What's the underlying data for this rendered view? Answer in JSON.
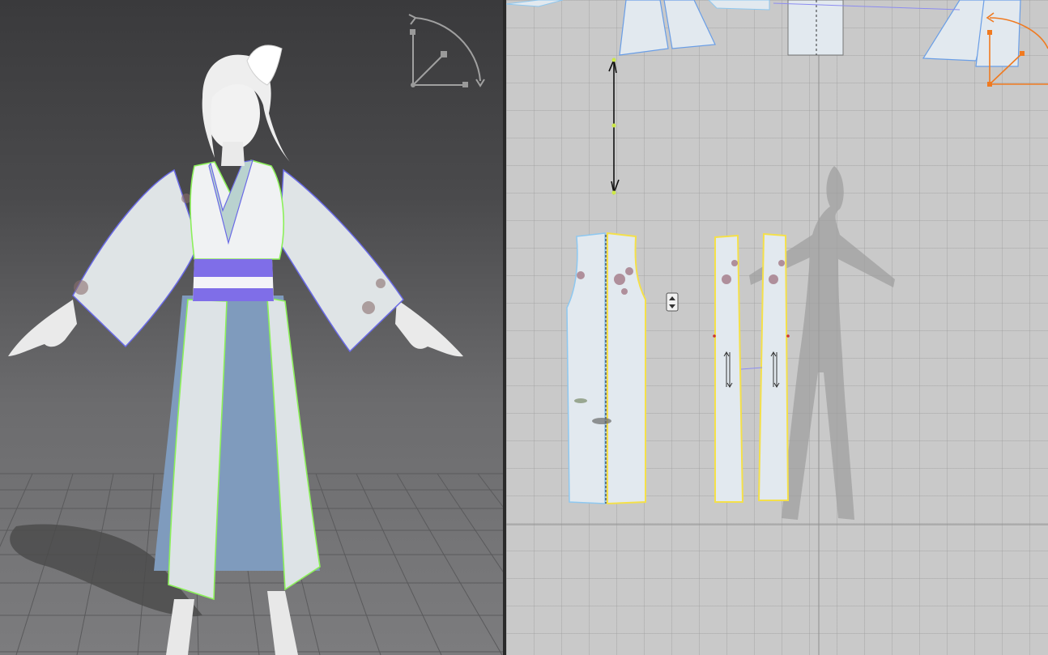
{
  "window": {
    "left_view": "3d-avatar-view",
    "right_view": "2d-pattern-view"
  },
  "colors": {
    "selection_outline_3d": "#8cf05a",
    "hem_outline": "#6a6ae6",
    "sash_purple": "#7f6ee8",
    "pattern_outline_selected": "#f4e04a",
    "pattern_outline_unselected": "#8ec8f0",
    "pattern_fill": "#e2e9ef",
    "skirt_blue": "#7f9bbd",
    "gizmo_2d": "#f07a20",
    "gizmo_3d": "#9a9a9a"
  },
  "pattern_pieces": [
    {
      "id": "front-body-left",
      "selected": false
    },
    {
      "id": "front-body-right",
      "selected": true
    },
    {
      "id": "gusset-left",
      "selected": true
    },
    {
      "id": "gusset-right",
      "selected": true
    }
  ],
  "icons": {
    "gizmo_3d": "rotate-gizmo-icon",
    "gizmo_2d": "transform-gizmo-icon",
    "mini_toggle": "up-down-toggle-icon"
  }
}
